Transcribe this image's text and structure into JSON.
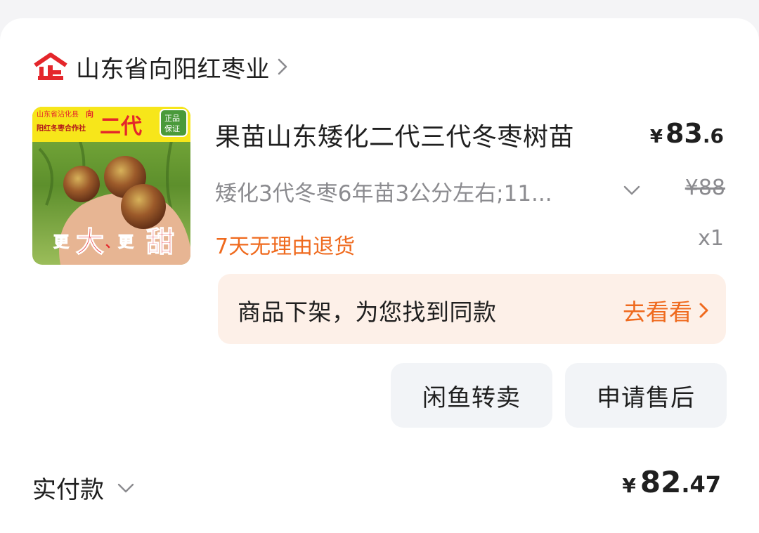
{
  "shop": {
    "logo_icon": "enterprise-qi-icon",
    "name": "山东省向阳红枣业",
    "accent": "#e4262b"
  },
  "product": {
    "image_icon": "winter-jujube-product-image",
    "image_texts": {
      "top_left_line1": "山东省沾化县",
      "top_left_highlight": "向",
      "top_left_line2": "阳红冬枣合作社",
      "generation": "二代",
      "badge_line1": "正品",
      "badge_line2": "保证",
      "slogan_1": "更",
      "slogan_2": "大",
      "slogan_sep": "、",
      "slogan_3": "更",
      "slogan_4": "甜"
    },
    "title": "果苗山东矮化二代三代冬枣树苗",
    "price": {
      "currency": "¥",
      "int": "83",
      "dec": ".6"
    },
    "sku": "矮化3代冬枣6年苗3公分左右;11...",
    "original_price": "¥88",
    "tag": "7天无理由退货",
    "tag_color": "#ef6a1e",
    "quantity": "x1"
  },
  "notice": {
    "text": "商品下架，为您找到同款",
    "link": "去看看",
    "bg_color": "#fdf0e8"
  },
  "actions": {
    "resell": "闲鱼转卖",
    "after_sale": "申请售后"
  },
  "payment": {
    "label": "实付款",
    "price": {
      "currency": "¥",
      "int": "82",
      "dec": ".47"
    }
  }
}
